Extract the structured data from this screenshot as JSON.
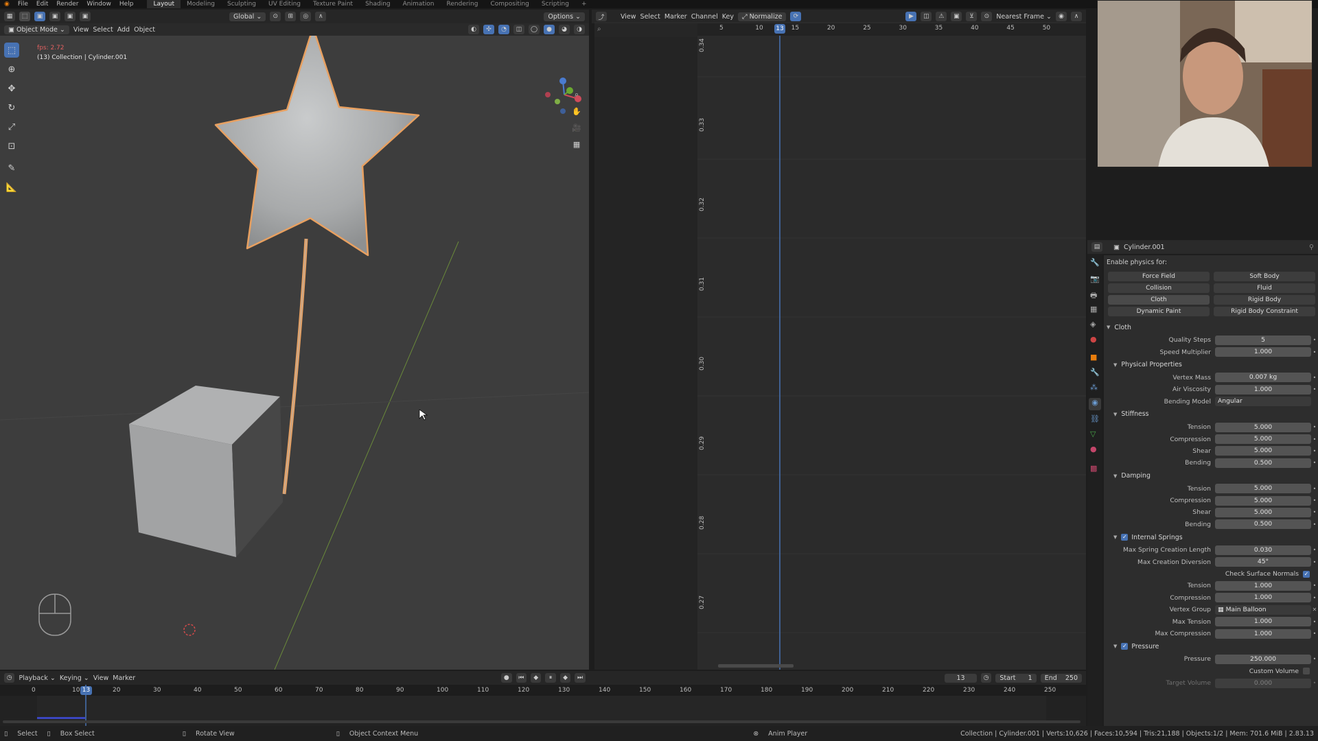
{
  "topbar": {
    "menu": [
      "File",
      "Edit",
      "Render",
      "Window",
      "Help"
    ],
    "workspaces": [
      "Layout",
      "Modeling",
      "Sculpting",
      "UV Editing",
      "Texture Paint",
      "Shading",
      "Animation",
      "Rendering",
      "Compositing",
      "Scripting"
    ],
    "active_workspace": "Layout",
    "add_tab": "+"
  },
  "viewport_header": {
    "transform_orientation": "Global",
    "options_label": "Options",
    "mode": "Object Mode",
    "menus": [
      "View",
      "Select",
      "Add",
      "Object"
    ]
  },
  "viewport": {
    "fps_text": "fps: 2.72",
    "collection_text": "(13) Collection | Cylinder.001"
  },
  "graph_header": {
    "menus": [
      "View",
      "Select",
      "Marker",
      "Channel",
      "Key"
    ],
    "normalize_label": "Normalize",
    "snap_mode": "Nearest Frame"
  },
  "graph": {
    "current_frame": "13",
    "frame_ticks": [
      "5",
      "10",
      "15",
      "20",
      "25",
      "30",
      "35",
      "40",
      "45",
      "50"
    ],
    "value_ticks": [
      "0.34",
      "0.33",
      "0.32",
      "0.31",
      "0.30",
      "0.29",
      "0.28",
      "0.27"
    ]
  },
  "timeline": {
    "menus": [
      "Playback",
      "Keying",
      "View",
      "Marker"
    ],
    "current_frame": "13",
    "start_label": "Start",
    "start_value": "1",
    "end_label": "End",
    "end_value": "250",
    "ticks": [
      "0",
      "10",
      "20",
      "30",
      "40",
      "50",
      "60",
      "70",
      "80",
      "90",
      "100",
      "110",
      "120",
      "130",
      "140",
      "150",
      "160",
      "170",
      "180",
      "190",
      "200",
      "210",
      "220",
      "230",
      "240",
      "250"
    ]
  },
  "statusbar": {
    "select": "Select",
    "box_select": "Box Select",
    "rotate_view": "Rotate View",
    "context_menu": "Object Context Menu",
    "anim_player": "Anim Player",
    "stats": "Collection | Cylinder.001 | Verts:10,626 | Faces:10,594 | Tris:21,188 | Objects:1/2 | Mem: 701.6 MiB | 2.83.13"
  },
  "properties": {
    "object_name": "Cylinder.001",
    "enable_physics_label": "Enable physics for:",
    "physics_buttons": [
      "Force Field",
      "Soft Body",
      "Collision",
      "Fluid",
      "Cloth",
      "Rigid Body",
      "Dynamic Paint",
      "Rigid Body Constraint"
    ],
    "cloth_panel": "Cloth",
    "quality_steps": {
      "label": "Quality Steps",
      "value": "5"
    },
    "speed_multiplier": {
      "label": "Speed Multiplier",
      "value": "1.000"
    },
    "physical_properties": "Physical Properties",
    "vertex_mass": {
      "label": "Vertex Mass",
      "value": "0.007 kg"
    },
    "air_viscosity": {
      "label": "Air Viscosity",
      "value": "1.000"
    },
    "bending_model": {
      "label": "Bending Model",
      "value": "Angular"
    },
    "stiffness": {
      "title": "Stiffness",
      "tension": {
        "label": "Tension",
        "value": "5.000"
      },
      "compression": {
        "label": "Compression",
        "value": "5.000"
      },
      "shear": {
        "label": "Shear",
        "value": "5.000"
      },
      "bending": {
        "label": "Bending",
        "value": "0.500"
      }
    },
    "damping": {
      "title": "Damping",
      "tension": {
        "label": "Tension",
        "value": "5.000"
      },
      "compression": {
        "label": "Compression",
        "value": "5.000"
      },
      "shear": {
        "label": "Shear",
        "value": "5.000"
      },
      "bending": {
        "label": "Bending",
        "value": "0.500"
      }
    },
    "internal_springs": {
      "title": "Internal Springs",
      "max_length": {
        "label": "Max Spring Creation Length",
        "value": "0.030"
      },
      "max_diversion": {
        "label": "Max Creation Diversion",
        "value": "45°"
      },
      "check_normals": "Check Surface Normals",
      "tension": {
        "label": "Tension",
        "value": "1.000"
      },
      "compression": {
        "label": "Compression",
        "value": "1.000"
      },
      "vertex_group": {
        "label": "Vertex Group",
        "value": "Main Balloon"
      },
      "max_tension": {
        "label": "Max Tension",
        "value": "1.000"
      },
      "max_compression": {
        "label": "Max Compression",
        "value": "1.000"
      }
    },
    "pressure": {
      "title": "Pressure",
      "pressure": {
        "label": "Pressure",
        "value": "250.000"
      },
      "custom_volume": "Custom Volume",
      "target_volume": {
        "label": "Target Volume",
        "value": "0.000"
      }
    }
  },
  "colors": {
    "viewport_bg": "#3d3d3d",
    "selection_outline": "#e8a060",
    "frame_indicator": "#4772b3"
  }
}
